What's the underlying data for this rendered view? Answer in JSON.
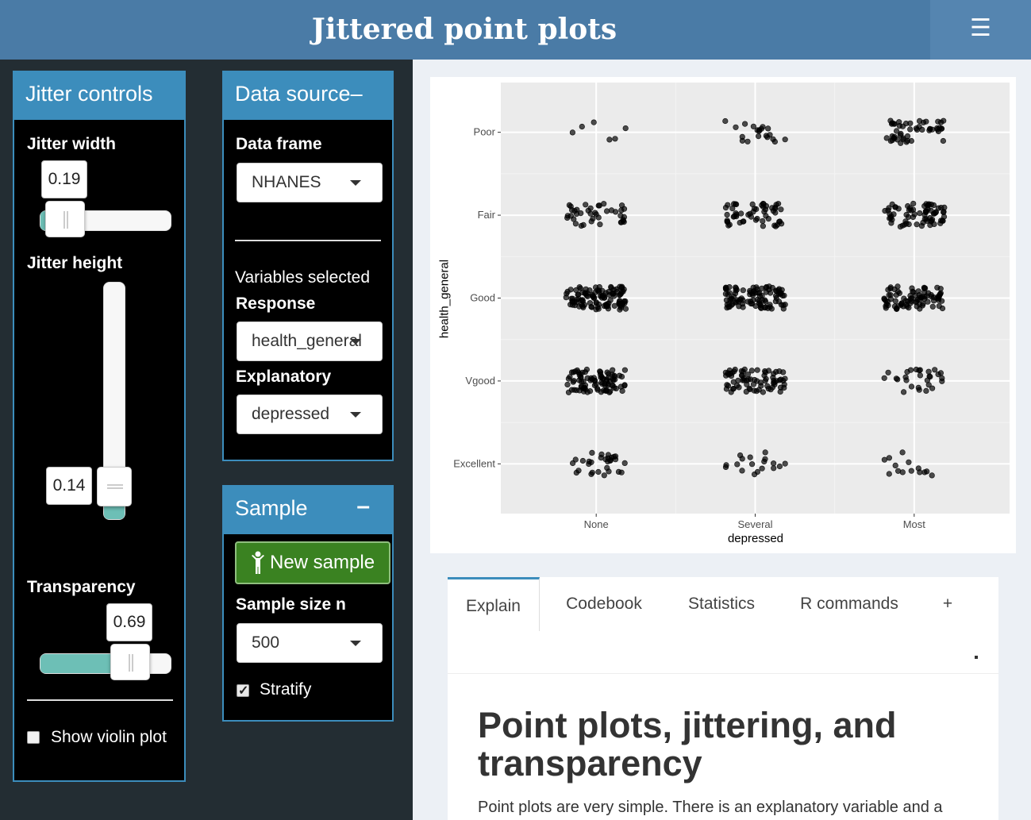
{
  "header": {
    "title": "Jittered point plots",
    "menu_icon": "hamburger-icon"
  },
  "jitter_controls": {
    "title": "Jitter controls",
    "jitter_width": {
      "label": "Jitter width",
      "value": "0.19",
      "fraction": 0.19
    },
    "jitter_height": {
      "label": "Jitter height",
      "value": "0.14",
      "fraction": 0.14
    },
    "transparency": {
      "label": "Transparency",
      "value": "0.69",
      "fraction": 0.69
    },
    "show_violin": {
      "label": "Show violin plot",
      "checked": false
    }
  },
  "data_source": {
    "title": "Data source",
    "collapse": "–",
    "data_frame": {
      "label": "Data frame",
      "value": "NHANES"
    },
    "variables_label": "Variables selected",
    "response": {
      "label": "Response",
      "value": "health_general"
    },
    "explanatory": {
      "label": "Explanatory",
      "value": "depressed"
    }
  },
  "sample": {
    "title": "Sample",
    "collapse": "–",
    "new_sample_label": "New sample",
    "sample_size": {
      "label": "Sample size n",
      "value": "500"
    },
    "stratify": {
      "label": "Stratify",
      "checked": true
    }
  },
  "chart_data": {
    "type": "scatter",
    "xlabel": "depressed",
    "ylabel": "health_general",
    "x_categories": [
      "None",
      "Several",
      "Most"
    ],
    "y_categories": [
      "Excellent",
      "Vgood",
      "Good",
      "Fair",
      "Poor"
    ],
    "points_per_cell": [
      [
        30,
        18,
        14
      ],
      [
        90,
        75,
        28
      ],
      [
        110,
        100,
        85
      ],
      [
        40,
        55,
        70
      ],
      [
        6,
        20,
        50
      ]
    ],
    "jitter_width": 0.19,
    "jitter_height": 0.14,
    "alpha": 0.69,
    "point_color": "#000000",
    "panel_background": "#ebebeb"
  },
  "tabs": {
    "items": [
      "Explain",
      "Codebook",
      "Statistics",
      "R commands",
      "+"
    ],
    "active": "Explain"
  },
  "doc": {
    "title": "Point plots, jittering, and transparency",
    "para": "Point plots are very simple. There is an explanatory variable and a"
  },
  "colors": {
    "header": "#4a7ba6",
    "box_header": "#3c8dbc",
    "slider_fill": "#6dbfb6",
    "button": "#3a8221"
  }
}
